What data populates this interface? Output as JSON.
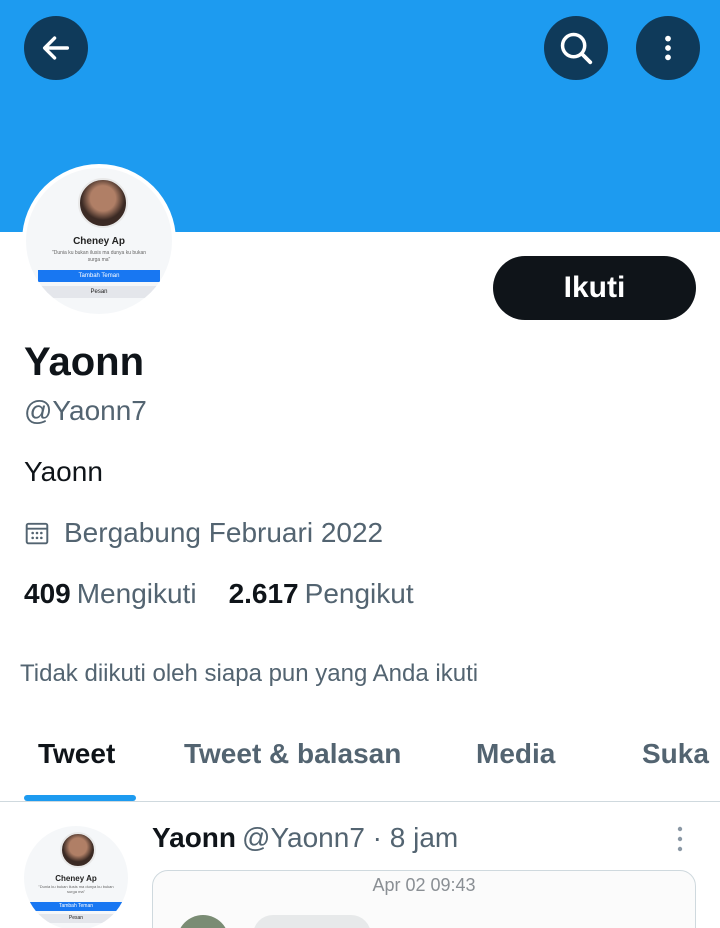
{
  "header": {
    "back_icon": "arrow-left-icon",
    "search_icon": "search-icon",
    "more_icon": "more-vertical-icon",
    "banner_color": "#1d9bf0"
  },
  "avatar": {
    "name": "Cheney Ap",
    "quote": "\"Dunia ku bukan ilusis ma dunya ku bukan surga ma\"",
    "add_friend": "Tambah Teman",
    "message": "Pesan"
  },
  "profile": {
    "follow_label": "Ikuti",
    "display_name": "Yaonn",
    "handle": "@Yaonn7",
    "bio": "Yaonn",
    "joined": "Bergabung Februari 2022",
    "following_count": "409",
    "following_label": "Mengikuti",
    "followers_count": "2.617",
    "followers_label": "Pengikut",
    "followed_note": "Tidak diikuti oleh siapa pun yang Anda ikuti"
  },
  "tabs": [
    {
      "label": "Tweet",
      "active": true
    },
    {
      "label": "Tweet & balasan",
      "active": false
    },
    {
      "label": "Media",
      "active": false
    },
    {
      "label": "Suka",
      "active": false
    }
  ],
  "tweet": {
    "display_name": "Yaonn",
    "meta": "@Yaonn7 · 8 jam",
    "media_timestamp": "Apr 02 09:43",
    "avatar_name": "Cheney Ap",
    "avatar_quote": "\"Dunia ku bukan ilusis ma dunya ku bukan surga ma\"",
    "avatar_add": "Tambah Teman",
    "avatar_msg": "Pesan"
  },
  "colors": {
    "accent": "#1d9bf0",
    "text_primary": "#0f1419",
    "text_secondary": "#536471"
  }
}
